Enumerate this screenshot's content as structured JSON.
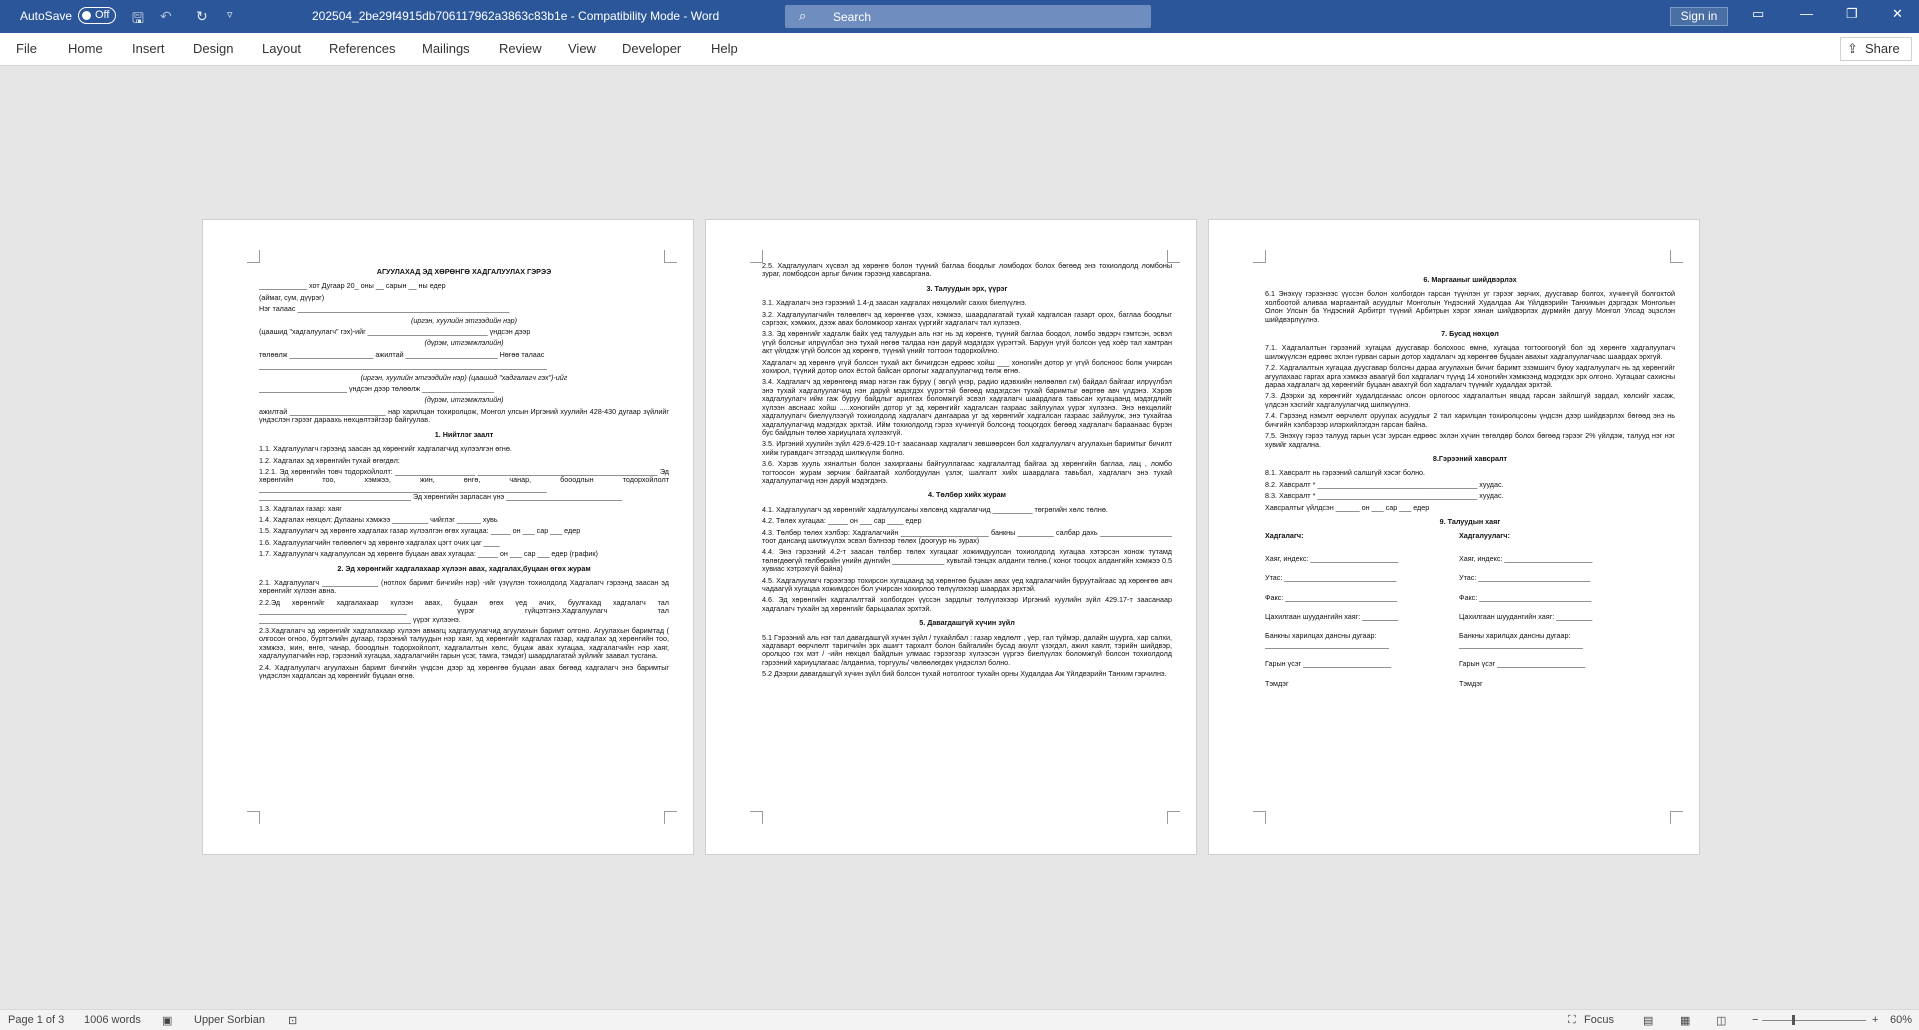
{
  "titlebar": {
    "autosave_label": "AutoSave",
    "autosave_state": "Off",
    "save_icon": "save-icon",
    "undo_icon": "undo-icon",
    "redo_icon": "redo-icon",
    "customize_icon": "customize-icon",
    "document_title": "202504_2be29f4915db706117962a3863c83b1e  -  Compatibility Mode  -  Word",
    "search_placeholder": "Search",
    "signin_label": "Sign in",
    "ribbon_display_icon": "ribbon-display-icon",
    "minimize_icon": "minimize-icon",
    "restore_icon": "restore-icon",
    "close_icon": "close-icon",
    "colors": {
      "bar": "#2b579a",
      "search_bg": "#6f8ebf"
    }
  },
  "ribbon": {
    "tabs": [
      "File",
      "Home",
      "Insert",
      "Design",
      "Layout",
      "References",
      "Mailings",
      "Review",
      "View",
      "Developer",
      "Help"
    ],
    "share_label": "Share"
  },
  "pages": {
    "p1": [
      {
        "s": "b",
        "t": "АГУУЛАХАД ЭД ХӨРӨНГӨ ХАДГАЛУУЛАХ ГЭРЭЭ"
      },
      {
        "s": "n",
        "t": "____________ хот                          Дугаар                  20_ оны __ сарын __ ны едер"
      },
      {
        "s": "n",
        "t": "(аймаг, сум, дүүрэг)"
      },
      {
        "s": "n",
        "t": "Нэг талаас _____________________________________________________"
      },
      {
        "s": "i",
        "t": "(иргэн, хуулийн этгээдийн нэр)"
      },
      {
        "s": "n",
        "t": "(цаашид \"хадгалуулагч\" гэх)-ийг ______________________________ үндсэн дээр"
      },
      {
        "s": "i",
        "t": "(дүрэм, итгэмжлэлийн)"
      },
      {
        "s": "n",
        "t": "төлөөлж _____________________ ажилтай _______________________ Нөгөө талаас"
      },
      {
        "s": "n",
        "t": "________________________________________________________________________"
      },
      {
        "s": "i",
        "t": "(иргэн, хуулийн этгээдийн нэр)        (цаашид \"хадгалагч гэх\")-ийг"
      },
      {
        "s": "n",
        "t": "______________________ үндсэн дээр төлөөлж __________________"
      },
      {
        "s": "i",
        "t": "(дүрэм, итгэмжлэлийн)"
      },
      {
        "s": "n",
        "t": "ажилтай ________________________ нар харилцан тохиролцож, Монгол улсын Иргэний хуулийн 428-430 дугаар зүйлийг үндэслэн гэрээг дараахь нөхцөлтэйгээр байгуулав."
      },
      {
        "s": "b",
        "t": "1.     Нийтлэг заалт"
      },
      {
        "s": "n",
        "t": "1.1. Хадгалуулагч гэрээнд заасан эд хөрөнгийг хадгалагчид хүлээлгэн өгнө."
      },
      {
        "s": "n",
        "t": "1.2. Хадгалах эд хөрөнгийн тухай өгөгдөл:"
      },
      {
        "s": "n",
        "t": "1.2.1.    Эд    хөрөнгийн    товч    тодорхойлолт:    ____________________ _____________________________________________ Эд хөрөнгийн тоо, хэмжээ,        жин,        өнгө,        чанар,        бооодлын        тодорхойлолт ________________________________________________________________________ ______________________________________ Эд        хөрөнгийн        зарласан        үнэ _____________________________"
      },
      {
        "s": "n",
        "t": "1.3. Хадгалах газар: хаяг"
      },
      {
        "s": "n",
        "t": "1.4. Хадгалах нөхцөл:  Дулааны хэмжээ _________ чийглэг ______ хувь"
      },
      {
        "s": "n",
        "t": "1.5. Хадгалуулагч эд хөрөнгө хадгалах газар хүлээлгэн өгөх хугацаа: _____ он ___ сар ___ едер"
      },
      {
        "s": "n",
        "t": "1.6. Хадгалуулагчийн төлөөлөгч эд хөрөнгө хадгалах цэгт очих цаг ____"
      },
      {
        "s": "n",
        "t": "1.7. Хадгалуулагч хадгалуулсан эд хөрөнгө буцаан авах хугацаа: _____ он ___ сар ___ едер (график)"
      },
      {
        "s": "b",
        "t": "2. Эд хөрөнгийг хадгалахаар хүлээн авах, хадгалах,буцаан өгөх журам"
      },
      {
        "s": "n",
        "t": "2.1.  Хадгалуулагч  ______________  (нотлох баримт бичгийн нэр) -ийг үзүүлэн тохиолдолд Хадгалагч гэрээнд заасан эд хөрөнгийг хүлээн авна."
      },
      {
        "s": "n",
        "t": "2.2.Эд  хөрөнгийг  хадгалахаар  хүлээн  авах,  буцаан  өгөх  үед  ачих,  буулгахад  хадгалагч тал _____________________________________ үүрэг гүйцэтгэнэ.Хадгалуулагч тал ______________________________________ үүрэг хүлээнэ."
      },
      {
        "s": "n",
        "t": "2.3.Хадгалагч  эд  хөрөнгийг  хадгалахаар  хүлээн  авмагц  хадгалуулагчид  агуулахын  баримт олгоно. Агуулахын баримтад ( олгосон огноо, бүртгэлийн дугаар, гэрээний талуудын нэр хаяг, эд хөрөнгийг хадгалах газар, хадгалах эд хөрөнгийн тоо, хэмжээ, жин, өнгө, чанар, бооодлын тодорхойлолт, хадгалалтын хөлс, буцаж авах хугацаа, хадгалагчийн нэр хаяг,  хадгалуулагчийн нэр, гэрээний хугацаа, хадгалагчийн гарын үсэг, тамга, тэмдэг)  шаардлагатай зүйлийг заавал тусгана."
      },
      {
        "s": "n",
        "t": "2.4.  Хадгалуулагч  агуулахын  баримт  бичгийн  үндсэн  дээр  эд  хөрөнгөө  буцаан  авах  бөгөөд хадгалагч энэ баримтыг үндэслэн хадгалсан эд хөрөнгийг буцаан өгнө."
      }
    ],
    "p2": [
      {
        "s": "n",
        "t": "2.5. Хадгалуулагч хүсвэл эд хөрөнгө болон түүний баглаа боодлыг ломбодох болох бөгөөд энэ тохиолдолд ломбоны зураг, ломбодсон аргыг бичиж гэрээнд хавсаргана."
      },
      {
        "s": "b",
        "t": "3. Талуудын эрх, үүрэг"
      },
      {
        "s": "n",
        "t": "3.1. Хадгалагч энэ гэрээний 1.4-д заасан хадгалах нөхцөлийг сахих биелүүлнэ."
      },
      {
        "s": "n",
        "t": "3.2.  Хадгалуулагчийн  төлөөлөгч  эд  хөрөнгөө  үзэх,  хэмжээ, шаардлагатай  тухай  хадгалсан  газарт  орох, баглаа боодлыг сэргээх,  хэмжих,  дээж авах боломжоор хангах үүргийг хадгалагч тал хүлээнэ."
      },
      {
        "s": "n",
        "t": "3.3.  Эд хөрөнгийг хадгалж байх үед талуудын аль нэг нь эд хөрөнгө, түүний баглаа боодол, ломбо эвдэрч гэмтсэн, эсвэл үгүй болсныг илрүүлбэл энэ тухай нөгөө талдаа нэн даруй мэдэгдэх үүрэгтэй. Баруун үгүй болсон үед хоёр тал хамтран акт үйлдэж үгүй болсон эд хөрөнгө, түүний үнийг тогтоон тодорхойлно."
      },
      {
        "s": "n",
        "t": "Хадгалагч эд хөрөнгө үгүй болсон тухай акт бичигдсэн едрөөс хойш ___ хоногийн дотор уг үгүй болсноос болж учирсан хохирол, түүний дотор олох ёстой байсан орлогыг хадгалуулагчид төлж өгнө."
      },
      {
        "s": "n",
        "t": "3.4.  Хадгалагч эд хөрөнгөнд ямар нэгэн гаж буруу ( эвгүй үнэр, радио идэвхийн нөлөөлөл г.м) байдал байгааг илрүүлбэл энэ тухай хадгалуулагчид нэн даруй мэдэгдэх үүрэгтэй бөгөөд мэдэгдсэн тухай баримтыг өөртөө авч үлдэнэ. Хэрэв хадгалуулагч ийм гаж буруу байдлыг арилгах боломжгүй эсвэл хадгалагч шаардлага тавьсан хугацаанд мэдэгдлийг хүлээн авснаас хойш .....хоногийн дотор уг эд хөрөнгийг хадгалсан газраас зайлуулах үүрэг хүлээнэ. Энэ нөхцөлийг хадгалуулагч биелүүлээгүй тохиолдолд хадгалагч дангаараа уг эд хөрөнгийг хадгалсан газраас зайлуулж, энэ тухайгаа хадгалуулагчид мэдэгдэх эрхтэй. Ийм тохиолдолд гэрээ хүчингүй болсонд тооцогдох бөгөөд хадгалагч бараанаас бүрэн бус байдлын төлөө хариуцлага хүлээхгүй."
      },
      {
        "s": "n",
        "t": "3.5.      Иргэний хуулийн зүйл 429.6-429.10-т заасанаар хадгалагч зөвшөөрсөн бол хадгалуулагч агуулахын баримтыг бичилт хийж гуравдагч этгээдэд шилжүүлж болно."
      },
      {
        "s": "n",
        "t": "3.6.      Хэрэв хууль хяналтын болон захиргааны байгууллагаас хадгалалтад байгаа эд хөрөнгийн баглаа, лац , ломбо тогтоосон журам зөрчиж байгаатай холбогдуулан  үзлэг, шалгалт хийх шаардлага тавьбал, хадгалагч энэ тухай хадгалуулагчид нэн даруй мэдэгдэнэ."
      },
      {
        "s": "b",
        "t": "4. Төлбөр хийх журам"
      },
      {
        "s": "n",
        "t": "4.1. Хадгалуулагч эд хөрөнгийг хадгалуулсаны хөлсөнд хадгалагчид __________ төгрөгийн хөлс төлнө."
      },
      {
        "s": "n",
        "t": "4.2. Төлөх хугацаа: _____ он ___ сар ____ едер"
      },
      {
        "s": "n",
        "t": "4.3.  Төлбөр  төлөх  хэлбэр:  Хадгалагчийн  ______________________  банкны  _________  салбар  дахь __________________ тоот дансанд шилжүүлэх эсвэл бэлнээр төлөх (доогуур нь зурах)"
      },
      {
        "s": "n",
        "t": "4.4.  Энэ  гэрээний  4.2-т  заасан  төлбөр  төлөх  хугацааг  хожимдуулсан  тохиолдолд  хугацаа хэтэрсэн хонож тутамд төлөгдөөгүй төлбөрийн үнийн дүнгийн _____________ хувьтай тэнцэх алданги төлнө.( хоног тооцох алдангийн хэмжээ 0.5 хувиас хэтрэхгүй байна)"
      },
      {
        "s": "n",
        "t": "4.5.  Хадгалуулагч  гэрээгээр  тохирсон  хугацаанд  эд  хөрөнгөө  буцаан  авах  үед  хадгалагчийн буруутайгаас эд хөрөнгөө авч чадаагүй хугацаа хожимдсон бол учирсан хохирлоо төлүүлэхээр шаардах эрхтэй."
      },
      {
        "s": "n",
        "t": "4.6.  Эд хөрөнгийн хадгалалттай холбогдон үүссэн зардлыг төлүүлэхээр Иргэний хуулийн зүйл 429.17-т заасанаар хадгалагч тухайн эд хөрөнгийг барьцаалах эрхтэй."
      },
      {
        "s": "b",
        "t": "5. Давагдашгүй хүчин зүйл"
      },
      {
        "s": "n",
        "t": "5.1 Гэрээний аль нэг тал давагдашгүй хүчин зүйл / тухайлбал : газар хөдлөлт , үер, гал түймэр, далайн шуурга, хар салхи, хадгаварт өөрчлөлт таригчийн эрх ашигт тархалт  болон байгалийн бусад аюулт үзэгдэл, ажил хаялт, тэрийн шийдвэр, оролцоо гэх мэт / -ийн нөхцөл байдлын улмаас гэрээгээр хүлээсэн үүргээ биелүүлэх боломжгүй болсон тохиолдолд гэрээний хариуцлагаас /алдангиа, торгууль/ чөлөөлөгдөх үндэслэл болно."
      },
      {
        "s": "n",
        "t": "5.2  Дээрхи давагдашгүй хүчин зүйл бий болсон тухай нотолгоог тухайн орны Худалдаа Аж Үйлдвэрийн Танхим гэрчилнэ."
      }
    ],
    "p3": [
      {
        "s": "b",
        "t": "6. Маргааныг шийдвэрлэх"
      },
      {
        "s": "n",
        "t": "6.1 Энэхүү гэрээнээс үүссэн болон холбогдон гарсан түүнлэн уг гэрээг зөрчих, дуусгавар болгох, хүчингүй болгохтой холбоотой аливаа маргаантай асуудлыг Монголын Үндэсний Худалдаа Аж Үйлдвэрийн Танхимын дэргэдэх Монголын Олон Улсын ба Үндэсний Арбитрт түүний Арбитрын хэрэг хянан шийдвэрлэх дүрмийн дагуу Монгол Улсад эцэслэн шийдвэрлүүлнэ."
      },
      {
        "s": "b",
        "t": "7. Бусад нөхцөл"
      },
      {
        "s": "n",
        "t": "7.1.  Хадгалалтын гэрээний хугацаа дуусгавар болохоос өмнө, хугацаа тогтоогоогүй бол эд хөрөнгө хадгалуулагч шилжүүлсэн едрөөс эхлэн гурван сарын дотор хадгалагч эд хөрөнгөө буцаан авахыг хадгалуулагчаас шаардах эрхгүй."
      },
      {
        "s": "n",
        "t": "7.2.  Хадгалалтын хугацаа дуусгавар болсны дараа агуулахын бичиг баримт эзэмшигч буюу хадгалуулагч нь эд хөрөнгийг агуулахаас гаргах арга хэмжээ аваагүй бол хадгалагч түүнд 14 хоногийн хэмжээнд мэдэгдэх эрх олгоно. Хугацааг сахисны дараа хадгалагч эд хөрөнгийг буцаан авахгүй бол хадгалагч түүнийг худалдах эрхтэй."
      },
      {
        "s": "n",
        "t": "7.3.  Дээрхи эд хөрөнгийг худалдсанаас олсон орлогоос хадгалалтын явцад гарсан зайлшгүй зардал, хөлсийг хасаж, үлдсэн хэсгийг хадгалуулагчид шилжүүлнэ."
      },
      {
        "s": "n",
        "t": "7.4.  Гэрээнд нэмэлт өөрчлөлт оруулах асуудлыг 2 тал харилцан тохиролцсоны үндсэн дээр шийдвэрлэх бөгөөд энэ нь бичгийн хэлбэрээр илэрхийлэгдэн гарсан байна."
      },
      {
        "s": "n",
        "t": "7.5.  Энэхүү гэрээ талууд гарын үсэг зурсан едрөөс эхлэн хүчин төгөлдөр болох бөгөөд гэрээг 2% үйлдэж, талууд нэг нэг хувийг хадгална."
      },
      {
        "s": "b",
        "t": "8.Гэрээний хавсралт"
      },
      {
        "s": "n",
        "t": "8.1. Хавсралт нь гэрээний салшгүй хэсэг болно."
      },
      {
        "s": "n",
        "t": "8.2. Хавсралт * ________________________________________ хуудас."
      },
      {
        "s": "n",
        "t": "8.3. Хавсралт * ________________________________________ хуудас."
      },
      {
        "s": "n",
        "t": "Хавсралтыг үйлдсэн ______ он ___ сар ___ едер"
      },
      {
        "s": "b",
        "t": "9. Талуудын хаяг"
      }
    ],
    "p3_signatures": {
      "left": [
        "Хадгалагч:",
        "Хаяг, индекс: ______________________",
        "Утас: ____________________________",
        "Факс: ____________________________",
        "Цахилгаан шуудангийн хаяг: _________",
        "Банкны харилцах дансны дугаар: _______________________________",
        "Гарын үсэг ______________________",
        "Тэмдэг"
      ],
      "right": [
        "Хадгалуулагч:",
        "Хаяг, индекс: ______________________",
        "Утас: ____________________________",
        "Факс: ____________________________",
        "Цахилгаан шуудангийн хаяг: _________",
        "Банкны харилцах дансны дугаар: _______________________________",
        "Гарын үсэг ______________________",
        "Тэмдэг"
      ]
    }
  },
  "statusbar": {
    "page": "Page 1 of 3",
    "words": "1006 words",
    "proofing_icon": "proofing-icon",
    "language": "Upper Sorbian",
    "macro_icon": "macro-record-icon",
    "focus_label": "Focus",
    "zoom": "60%"
  }
}
